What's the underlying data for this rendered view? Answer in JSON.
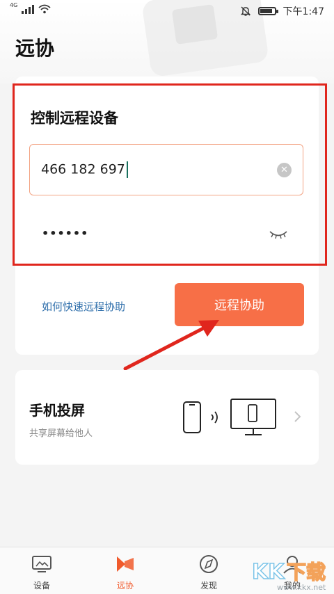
{
  "status_bar": {
    "network": "4G",
    "time": "下午1:47",
    "battery_level": 0.85
  },
  "page": {
    "title": "远协"
  },
  "remote_control": {
    "section_title": "控制远程设备",
    "device_id_value": "466 182 697",
    "password_value": "••••••",
    "help_link": "如何快速远程协助",
    "assist_button": "远程协助"
  },
  "screen_cast": {
    "title": "手机投屏",
    "subtitle": "共享屏幕给他人"
  },
  "tab_bar": {
    "items": [
      {
        "label": "设备",
        "icon": "monitor-icon",
        "active": false
      },
      {
        "label": "远协",
        "icon": "remote-assist-icon",
        "active": true
      },
      {
        "label": "发现",
        "icon": "compass-icon",
        "active": false
      },
      {
        "label": "我的",
        "icon": "profile-icon",
        "active": false
      }
    ]
  },
  "watermark": {
    "brand": "KK下载",
    "url": "www.kkx.net"
  },
  "colors": {
    "accent": "#f76f47",
    "highlight_box": "#e0261d",
    "link": "#2f6fab",
    "tab_active": "#f05a2c"
  }
}
